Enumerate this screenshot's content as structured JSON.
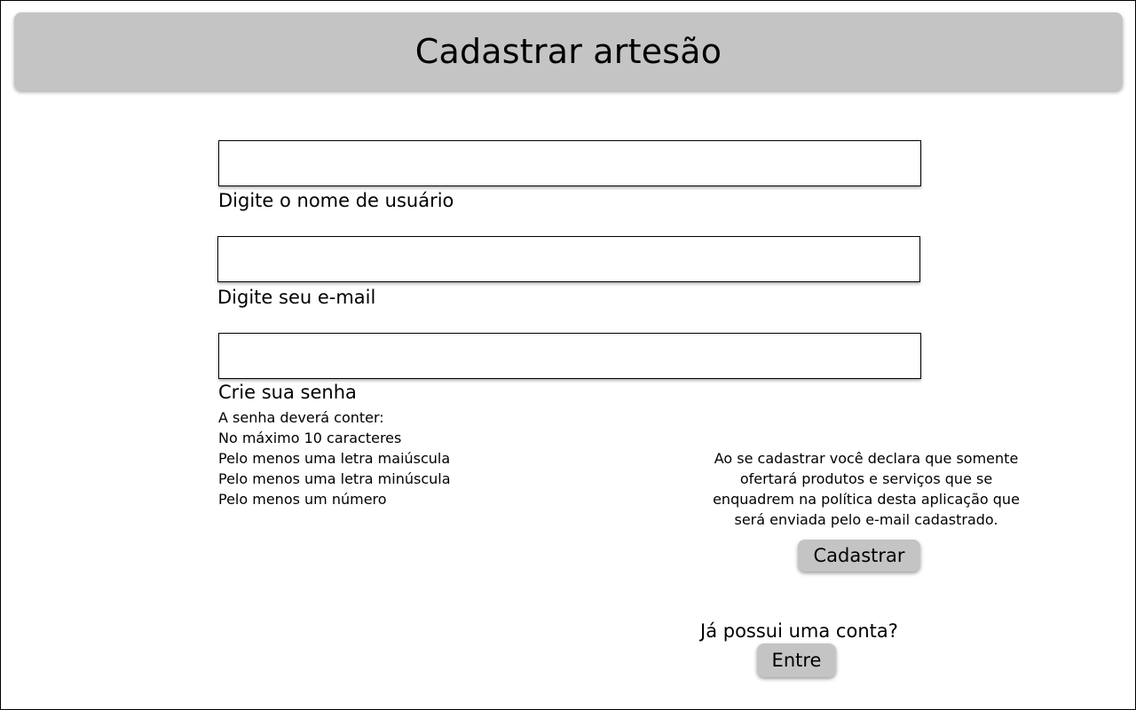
{
  "header": {
    "title": "Cadastrar artesão"
  },
  "form": {
    "username": {
      "value": "",
      "label": "Digite o nome de usuário"
    },
    "email": {
      "value": "",
      "label": "Digite seu e-mail"
    },
    "password": {
      "value": "",
      "label": "Crie sua senha",
      "rules": [
        "A senha deverá conter:",
        "No máximo 10 caracteres",
        "Pelo menos uma letra maiúscula",
        "Pelo menos uma letra minúscula",
        "Pelo menos um número"
      ]
    }
  },
  "notice": {
    "lines": [
      "Ao se cadastrar você declara que somente",
      "ofertará produtos e serviços que se",
      "enquadrem na política desta aplicação que",
      "será enviada pelo e-mail cadastrado."
    ]
  },
  "actions": {
    "register_label": "Cadastrar",
    "account_question": "Já possui uma conta?",
    "login_label": "Entre"
  },
  "colors": {
    "header_bg": "#c4c4c4",
    "button_bg": "#c4c4c4",
    "border": "#000000"
  }
}
